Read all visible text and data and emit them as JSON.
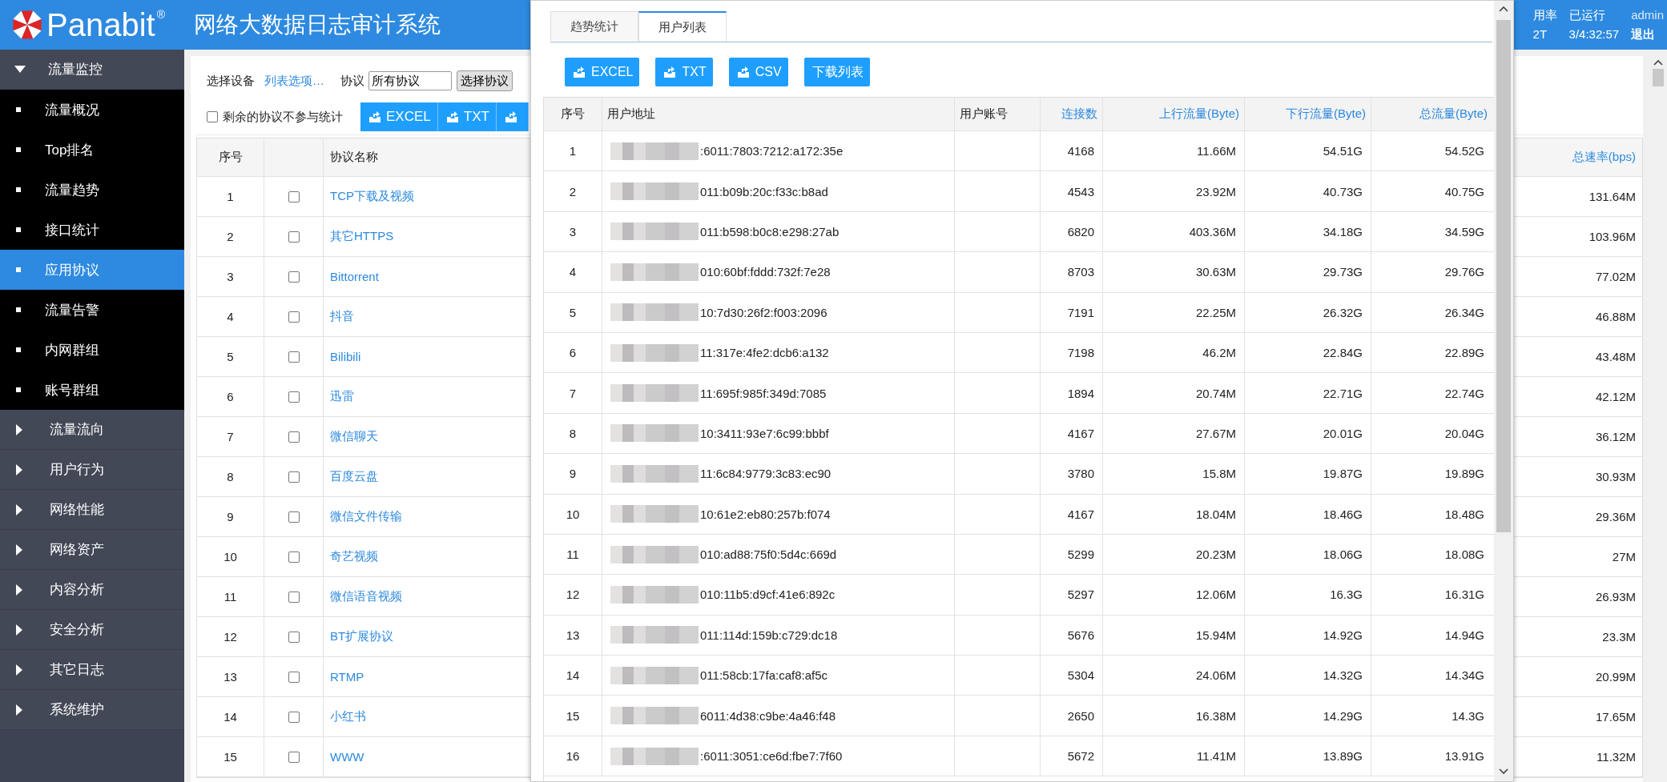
{
  "header": {
    "brand": "Panabit",
    "registered": "®",
    "title": "网络大数据日志审计系统",
    "stats": [
      {
        "label": "用率",
        "value": "2T"
      },
      {
        "label": "已运行",
        "value": "3/4:32:57"
      }
    ],
    "user": {
      "name": "admin",
      "logout": "退出"
    }
  },
  "sidebar": {
    "groups": [
      {
        "label": "流量监控",
        "expanded": true,
        "children": [
          {
            "label": "流量概况",
            "selected": false
          },
          {
            "label": "Top排名",
            "selected": false
          },
          {
            "label": "流量趋势",
            "selected": false
          },
          {
            "label": "接口统计",
            "selected": false
          },
          {
            "label": "应用协议",
            "selected": true
          },
          {
            "label": "流量告警",
            "selected": false
          },
          {
            "label": "内网群组",
            "selected": false
          },
          {
            "label": "账号群组",
            "selected": false
          }
        ]
      },
      {
        "label": "流量流向",
        "expanded": false
      },
      {
        "label": "用户行为",
        "expanded": false
      },
      {
        "label": "网络性能",
        "expanded": false
      },
      {
        "label": "网络资产",
        "expanded": false
      },
      {
        "label": "内容分析",
        "expanded": false
      },
      {
        "label": "安全分析",
        "expanded": false
      },
      {
        "label": "其它日志",
        "expanded": false
      },
      {
        "label": "系统维护",
        "expanded": false
      }
    ]
  },
  "main": {
    "device_label": "选择设备",
    "device_link": "列表选项…",
    "protocol_label": "协议",
    "protocol_value": "所有协议",
    "protocol_button": "选择协议",
    "exclude": {
      "label": "剩余的协议不参与统计",
      "checked": false
    },
    "export_buttons": [
      {
        "kind": "labeled",
        "label": "EXCEL"
      },
      {
        "kind": "labeled",
        "label": "TXT"
      },
      {
        "kind": "icon"
      }
    ],
    "table": {
      "columns": [
        {
          "kind": "index",
          "label": "序号"
        },
        {
          "kind": "select"
        },
        {
          "kind": "name",
          "label": "协议名称"
        },
        {
          "kind": "rate",
          "label": "总速率(bps)"
        }
      ],
      "rows": [
        {
          "index": "1",
          "checked": false,
          "name": "TCP下载及视频",
          "total_rate": "131.64M"
        },
        {
          "index": "2",
          "checked": false,
          "name": "其它HTTPS",
          "total_rate": "103.96M"
        },
        {
          "index": "3",
          "checked": false,
          "name": "Bittorrent",
          "total_rate": "77.02M"
        },
        {
          "index": "4",
          "checked": false,
          "name": "抖音",
          "total_rate": "46.88M"
        },
        {
          "index": "5",
          "checked": false,
          "name": "Bilibili",
          "total_rate": "43.48M"
        },
        {
          "index": "6",
          "checked": false,
          "name": "迅雷",
          "total_rate": "42.12M"
        },
        {
          "index": "7",
          "checked": false,
          "name": "微信聊天",
          "total_rate": "36.12M"
        },
        {
          "index": "8",
          "checked": false,
          "name": "百度云盘",
          "total_rate": "30.93M"
        },
        {
          "index": "9",
          "checked": false,
          "name": "微信文件传输",
          "total_rate": "29.36M"
        },
        {
          "index": "10",
          "checked": false,
          "name": "奇艺视频",
          "total_rate": "27M"
        },
        {
          "index": "11",
          "checked": false,
          "name": "微信语音视频",
          "total_rate": "26.93M"
        },
        {
          "index": "12",
          "checked": false,
          "name": "BT扩展协议",
          "total_rate": "23.3M"
        },
        {
          "index": "13",
          "checked": false,
          "name": "RTMP",
          "total_rate": "20.99M"
        },
        {
          "index": "14",
          "checked": false,
          "name": "小红书",
          "total_rate": "17.65M"
        },
        {
          "index": "15",
          "checked": false,
          "name": "WWW",
          "total_rate": "11.32M"
        }
      ]
    }
  },
  "dialog": {
    "tabs": [
      {
        "label": "趋势统计",
        "selected": false
      },
      {
        "label": "用户列表",
        "selected": true
      }
    ],
    "buttons": [
      {
        "kind": "export",
        "label": "EXCEL"
      },
      {
        "kind": "export",
        "label": "TXT"
      },
      {
        "kind": "export",
        "label": "CSV"
      },
      {
        "kind": "plain",
        "label": "下载列表"
      }
    ],
    "table": {
      "columns": [
        {
          "kind": "index",
          "label": "序号",
          "sortable": false
        },
        {
          "kind": "text",
          "label": "用户地址",
          "sortable": false
        },
        {
          "kind": "text",
          "label": "用户账号",
          "sortable": false
        },
        {
          "kind": "number",
          "label": "连接数",
          "sortable": true
        },
        {
          "kind": "number",
          "label": "上行流量(Byte)",
          "sortable": true
        },
        {
          "kind": "number",
          "label": "下行流量(Byte)",
          "sortable": true
        },
        {
          "kind": "number",
          "label": "总流量(Byte)",
          "sortable": true
        }
      ],
      "rows": [
        {
          "index": "1",
          "address": ":6011:7803:7212:a172:35e",
          "connections": "4168",
          "upload": "11.66M",
          "download": "54.51G",
          "total": "54.52G"
        },
        {
          "index": "2",
          "address": "011:b09b:20c:f33c:b8ad",
          "connections": "4543",
          "upload": "23.92M",
          "download": "40.73G",
          "total": "40.75G"
        },
        {
          "index": "3",
          "address": "011:b598:b0c8:e298:27ab",
          "connections": "6820",
          "upload": "403.36M",
          "download": "34.18G",
          "total": "34.59G"
        },
        {
          "index": "4",
          "address": "010:60bf:fddd:732f:7e28",
          "connections": "8703",
          "upload": "30.63M",
          "download": "29.73G",
          "total": "29.76G"
        },
        {
          "index": "5",
          "address": "10:7d30:26f2:f003:2096",
          "connections": "7191",
          "upload": "22.25M",
          "download": "26.32G",
          "total": "26.34G"
        },
        {
          "index": "6",
          "address": "11:317e:4fe2:dcb6:a132",
          "connections": "7198",
          "upload": "46.2M",
          "download": "22.84G",
          "total": "22.89G"
        },
        {
          "index": "7",
          "address": "11:695f:985f:349d:7085",
          "connections": "1894",
          "upload": "20.74M",
          "download": "22.71G",
          "total": "22.74G"
        },
        {
          "index": "8",
          "address": "10:3411:93e7:6c99:bbbf",
          "connections": "4167",
          "upload": "27.67M",
          "download": "20.01G",
          "total": "20.04G"
        },
        {
          "index": "9",
          "address": "11:6c84:9779:3c83:ec90",
          "connections": "3780",
          "upload": "15.8M",
          "download": "19.87G",
          "total": "19.89G"
        },
        {
          "index": "10",
          "address": "10:61e2:eb80:257b:f074",
          "connections": "4167",
          "upload": "18.04M",
          "download": "18.46G",
          "total": "18.48G"
        },
        {
          "index": "11",
          "address": "010:ad88:75f0:5d4c:669d",
          "connections": "5299",
          "upload": "20.23M",
          "download": "18.06G",
          "total": "18.08G"
        },
        {
          "index": "12",
          "address": "010:11b5:d9cf:41e6:892c",
          "connections": "5297",
          "upload": "12.06M",
          "download": "16.3G",
          "total": "16.31G"
        },
        {
          "index": "13",
          "address": "011:114d:159b:c729:dc18",
          "connections": "5676",
          "upload": "15.94M",
          "download": "14.92G",
          "total": "14.94G"
        },
        {
          "index": "14",
          "address": "011:58cb:17fa:caf8:af5c",
          "connections": "5304",
          "upload": "24.06M",
          "download": "14.32G",
          "total": "14.34G"
        },
        {
          "index": "15",
          "address": "6011:4d38:c9be:4a46:f48",
          "connections": "2650",
          "upload": "16.38M",
          "download": "14.29G",
          "total": "14.3G"
        },
        {
          "index": "16",
          "address": ":6011:3051:ce6d:fbe7:7f60",
          "connections": "5672",
          "upload": "11.41M",
          "download": "13.89G",
          "total": "13.91G"
        }
      ]
    }
  }
}
